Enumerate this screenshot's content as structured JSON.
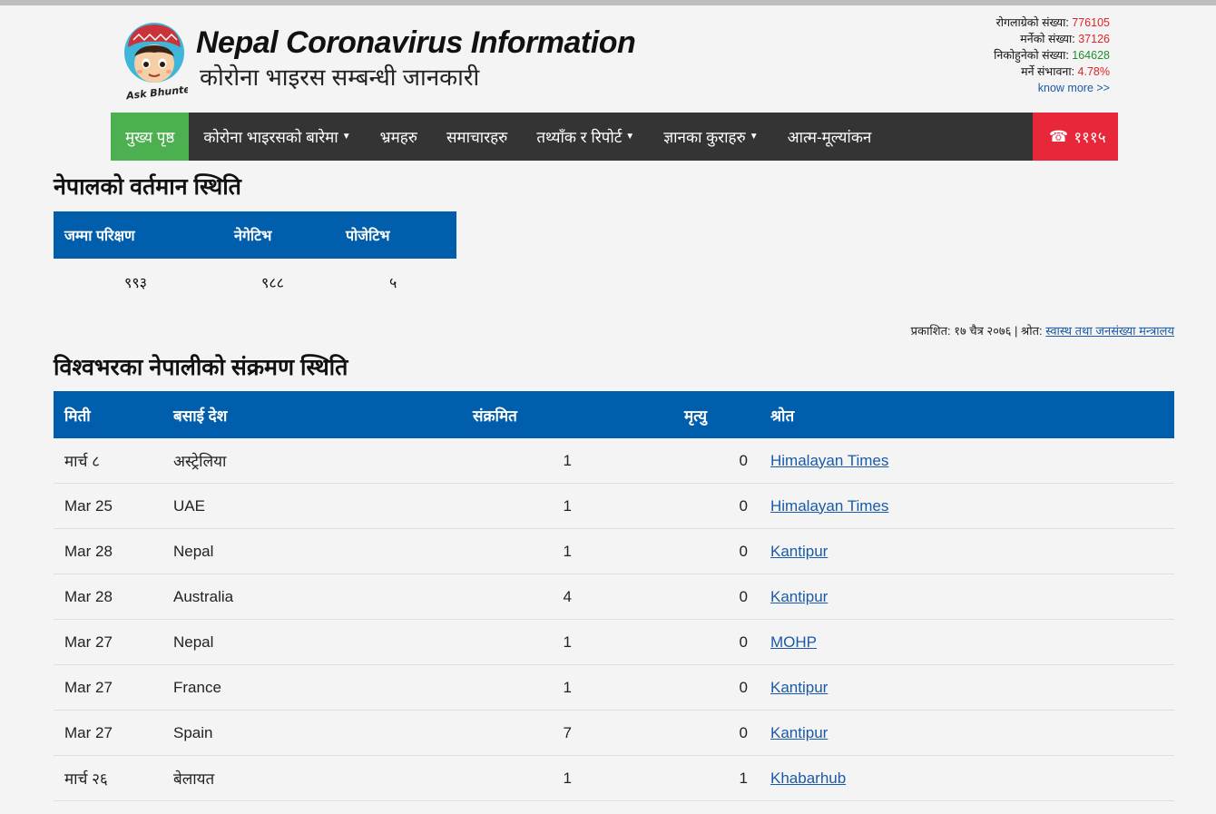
{
  "header": {
    "title": "Nepal Coronavirus Information",
    "subtitle": "कोरोना भाइरस सम्बन्धी जानकारी",
    "logo_text": "Ask Bhunte"
  },
  "stats": {
    "infected_label": "रोगलाग्रेको संख्या:",
    "infected_value": "776105",
    "deaths_label": "मर्नेको संख्या:",
    "deaths_value": "37126",
    "recovered_label": "निकोहुनेको संख्या:",
    "recovered_value": "164628",
    "fatality_label": "मर्ने संभावना:",
    "fatality_value": "4.78%",
    "know_more": "know more >>"
  },
  "nav": {
    "home": "मुख्य पृष्ठ",
    "about": "कोरोना भाइरसको बारेमा",
    "myths": "भ्रमहरु",
    "news": "समाचारहरु",
    "data": "तथ्याँक र रिपोर्ट",
    "knowledge": "ज्ञानका कुराहरु",
    "self_assessment": "आत्म-मूल्यांकन",
    "hotline": "१११५"
  },
  "current": {
    "heading": "नेपालको वर्तमान स्थिति",
    "columns": [
      "जम्मा परिक्षण",
      "नेगेटिभ",
      "पोजेटिभ"
    ],
    "values": [
      "९९३",
      "९८८",
      "५"
    ]
  },
  "published": {
    "text": "प्रकाशित: १७ चैत्र २०७६ | श्रोत:",
    "source_link": "स्वास्थ तथा जनसंख्या मन्त्रालय"
  },
  "world": {
    "heading": "विश्वभरका नेपालीको संक्रमण स्थिति",
    "columns": [
      "मिती",
      "बसाई देश",
      "संक्रमित",
      "मृत्यु",
      "श्रोत"
    ],
    "rows": [
      {
        "date": "मार्च ८",
        "country": "अस्ट्रेलिया",
        "infected": "1",
        "deaths": "0",
        "source": "Himalayan Times"
      },
      {
        "date": "Mar 25",
        "country": "UAE",
        "infected": "1",
        "deaths": "0",
        "source": "Himalayan Times"
      },
      {
        "date": "Mar 28",
        "country": "Nepal",
        "infected": "1",
        "deaths": "0",
        "source": "Kantipur"
      },
      {
        "date": "Mar 28",
        "country": "Australia",
        "infected": "4",
        "deaths": "0",
        "source": "Kantipur"
      },
      {
        "date": "Mar 27",
        "country": "Nepal",
        "infected": "1",
        "deaths": "0",
        "source": "MOHP"
      },
      {
        "date": "Mar 27",
        "country": "France",
        "infected": "1",
        "deaths": "0",
        "source": "Kantipur"
      },
      {
        "date": "Mar 27",
        "country": "Spain",
        "infected": "7",
        "deaths": "0",
        "source": "Kantipur"
      },
      {
        "date": "मार्च २६",
        "country": "बेलायत",
        "infected": "1",
        "deaths": "1",
        "source": "Khabarhub"
      }
    ]
  }
}
